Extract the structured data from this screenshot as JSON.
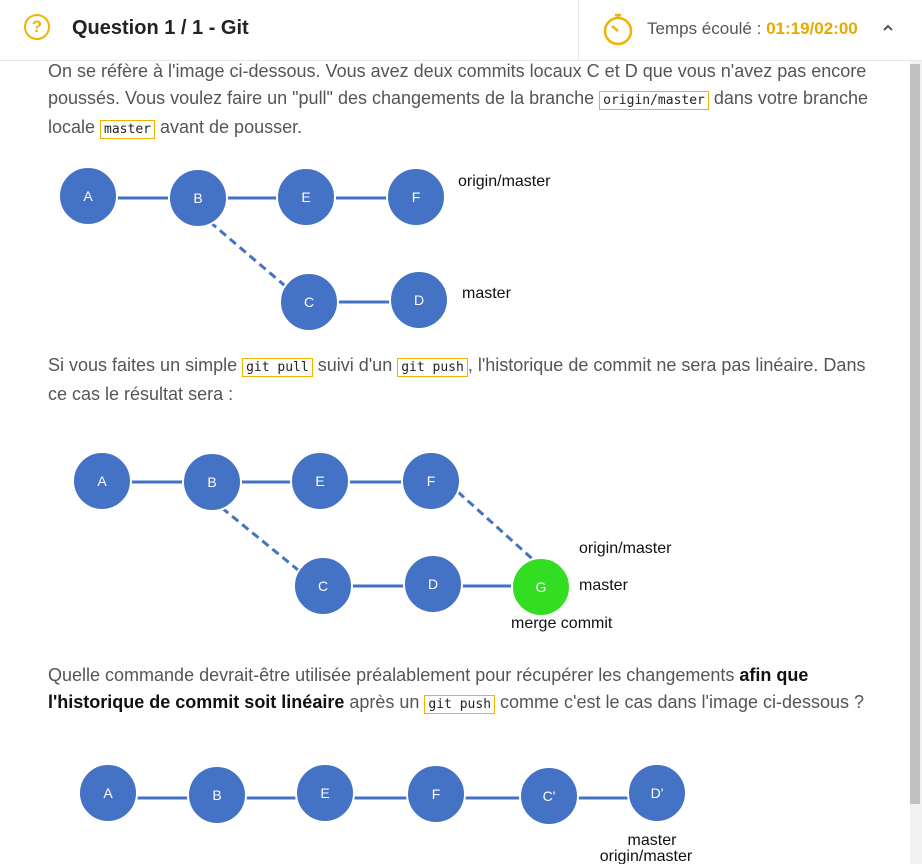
{
  "header": {
    "question_icon": "question-circle-icon",
    "title": "Question 1 / 1 - Git",
    "timer_icon": "stopwatch-icon",
    "timer_label": "Temps écoulé : ",
    "timer_value": "01:19/02:00",
    "collapse_icon": "chevron-up-icon",
    "accent_color": "#f0b400"
  },
  "question": {
    "para1": {
      "t1": "On se réfère à l'image ci-dessous. Vous avez deux commits locaux C et D que vous n'avez pas encore poussés. Vous voulez faire un \"pull\" des changements de la branche ",
      "code1": "origin/master",
      "t2": " dans votre branche locale ",
      "code2": "master",
      "t3": " avant de pousser."
    },
    "para2": {
      "t1": "Si vous faites un simple ",
      "code1": "git pull",
      "t2": " suivi d'un ",
      "code2": "git push",
      "t3": ", l'historique de commit ne sera pas linéaire. Dans ce cas le résultat sera :"
    },
    "para3": {
      "t1": "Quelle commande devrait-être utilisée préalablement pour récupérer les changements ",
      "bold": "afin que l'historique de commit soit linéaire",
      "t2": " après un ",
      "code1": "git push",
      "t3": "  comme c'est le cas dans l'image ci-dessous ?"
    }
  },
  "diagram1": {
    "nodes": [
      "A",
      "B",
      "E",
      "F",
      "C",
      "D"
    ],
    "labels": {
      "origin": "origin/master",
      "master": "master"
    }
  },
  "diagram2": {
    "nodes": [
      "A",
      "B",
      "E",
      "F",
      "C",
      "D",
      "G"
    ],
    "labels": {
      "origin": "origin/master",
      "master": "master",
      "merge": "merge commit"
    }
  },
  "diagram3": {
    "nodes": [
      "A",
      "B",
      "E",
      "F",
      "C'",
      "D'"
    ],
    "labels": {
      "master": "master",
      "origin": "origin/master"
    }
  },
  "colors": {
    "node": "#4472c4",
    "node_stroke": "#ffffff",
    "merge_node": "#33dd22",
    "line": "#4472c4"
  }
}
